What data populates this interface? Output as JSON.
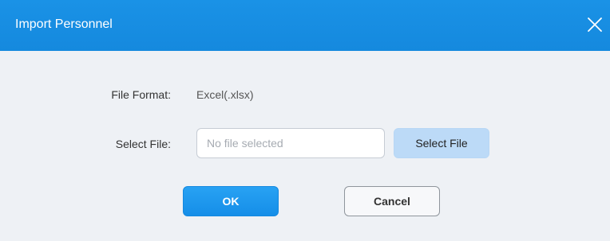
{
  "dialog": {
    "title": "Import Personnel",
    "close_icon": "close-icon",
    "file_format": {
      "label": "File Format:",
      "value": "Excel(.xlsx)"
    },
    "select_file": {
      "label": "Select File:",
      "placeholder": "No file selected",
      "value": "",
      "button_label": "Select File"
    },
    "buttons": {
      "ok_label": "OK",
      "cancel_label": "Cancel"
    }
  },
  "colors": {
    "titlebar": "#1a8fe3",
    "ok_button": "#1c95ec",
    "select_file_button": "#bcdaf7",
    "background": "#eef1f5"
  }
}
